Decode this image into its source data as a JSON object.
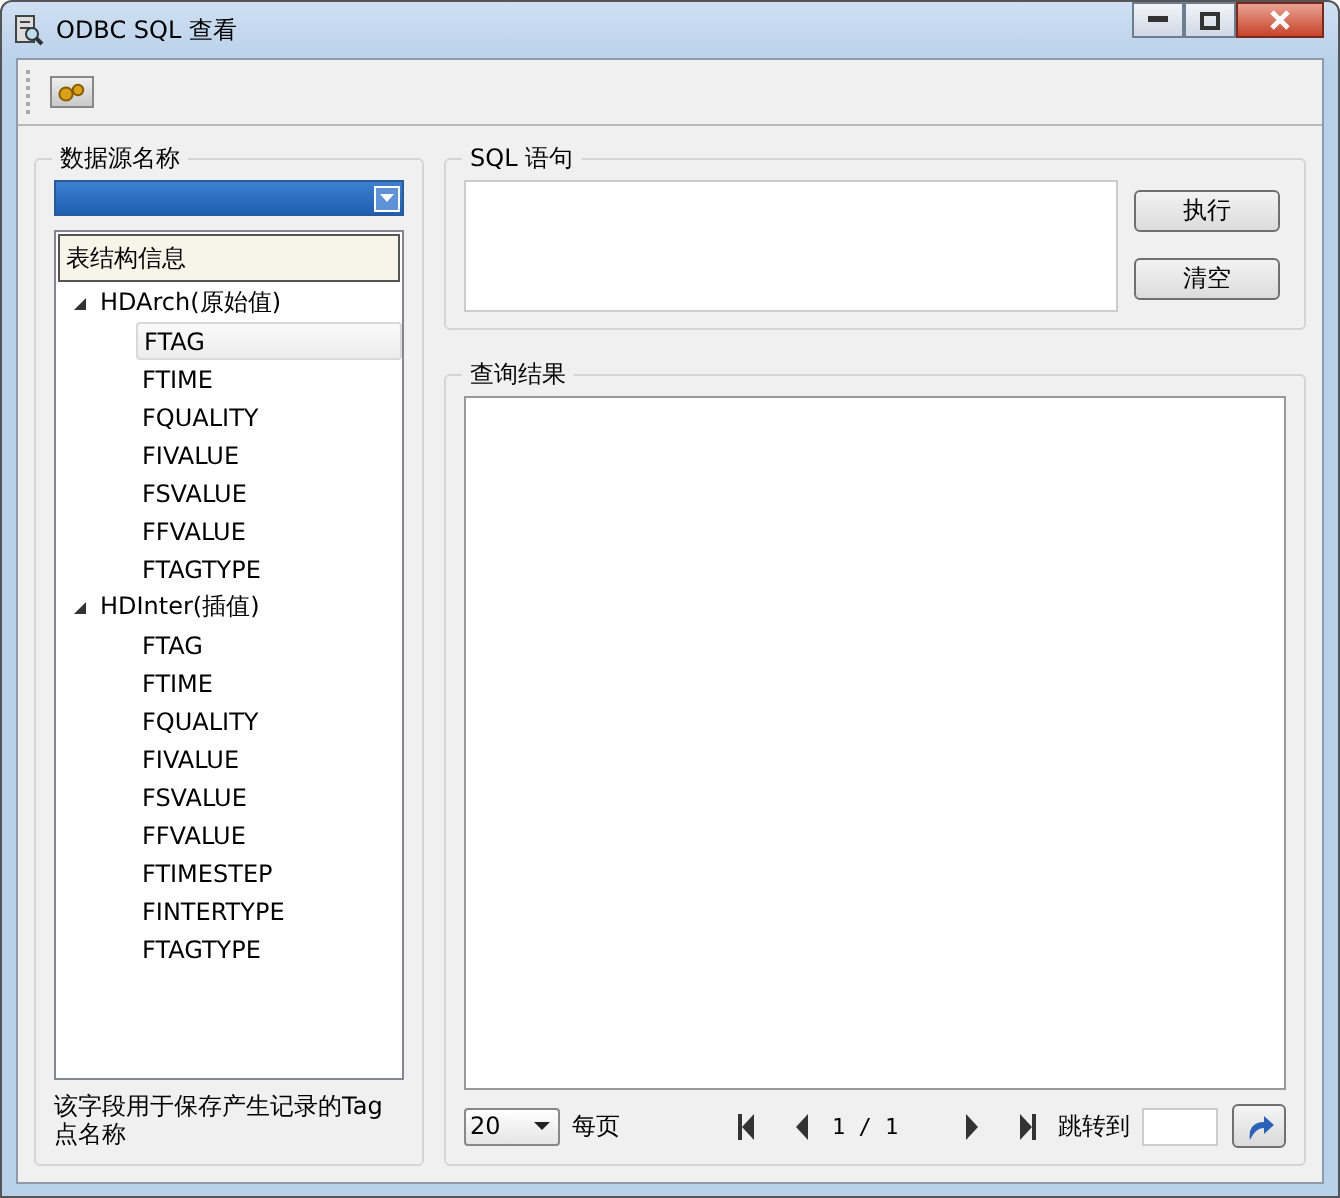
{
  "window": {
    "title": "ODBC SQL 查看"
  },
  "datasource": {
    "label": "数据源名称"
  },
  "tree": {
    "header": "表结构信息",
    "nodes": [
      {
        "label": "HDArch(原始值)",
        "expanded": true,
        "children": [
          {
            "label": "FTAG",
            "selected": true
          },
          {
            "label": "FTIME",
            "selected": false
          },
          {
            "label": "FQUALITY",
            "selected": false
          },
          {
            "label": "FIVALUE",
            "selected": false
          },
          {
            "label": "FSVALUE",
            "selected": false
          },
          {
            "label": "FFVALUE",
            "selected": false
          },
          {
            "label": "FTAGTYPE",
            "selected": false
          }
        ]
      },
      {
        "label": "HDInter(插值)",
        "expanded": true,
        "children": [
          {
            "label": "FTAG",
            "selected": false
          },
          {
            "label": "FTIME",
            "selected": false
          },
          {
            "label": "FQUALITY",
            "selected": false
          },
          {
            "label": "FIVALUE",
            "selected": false
          },
          {
            "label": "FSVALUE",
            "selected": false
          },
          {
            "label": "FFVALUE",
            "selected": false
          },
          {
            "label": "FTIMESTEP",
            "selected": false
          },
          {
            "label": "FINTERTYPE",
            "selected": false
          },
          {
            "label": "FTAGTYPE",
            "selected": false
          }
        ]
      }
    ]
  },
  "description": "该字段用于保存产生记录的Tag点名称",
  "sql": {
    "label": "SQL 语句",
    "buttons": [
      "执行",
      "清空"
    ]
  },
  "results": {
    "label": "查询结果"
  },
  "pager": {
    "page_size": "20",
    "per_page_label": "每页",
    "page": "1 / 1",
    "goto_label": "跳转到"
  }
}
